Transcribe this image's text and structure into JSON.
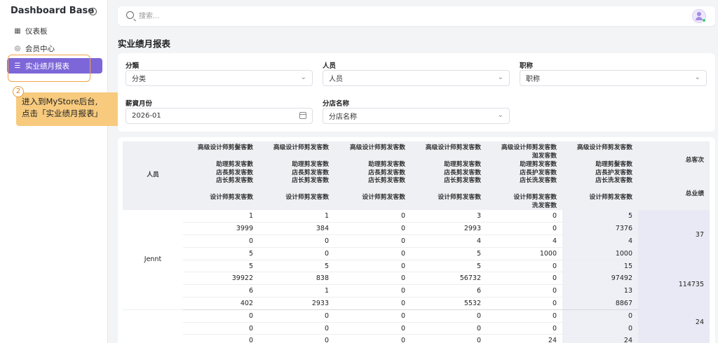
{
  "app": {
    "title": "Dashboard Base"
  },
  "sidebar": {
    "items": [
      {
        "label": "仪表板",
        "icon": "grid-icon"
      },
      {
        "label": "会员中心",
        "icon": "user-circle-icon"
      },
      {
        "label": "实业绩月报表",
        "icon": "list-icon",
        "active": true
      }
    ]
  },
  "callout": {
    "step": "2",
    "line1": "进入到MyStore后台,",
    "line2": "点击「实业绩月报表」"
  },
  "search": {
    "placeholder": "搜索..."
  },
  "page": {
    "title": "实业绩月报表"
  },
  "filters": {
    "category": {
      "label": "分類",
      "value": "分类"
    },
    "staff": {
      "label": "人员",
      "value": "人员"
    },
    "title": {
      "label": "职称",
      "value": "职称"
    },
    "month": {
      "label": "薪資月份",
      "value": "2026-01"
    },
    "branch": {
      "label": "分店名称",
      "value": "分店名称"
    }
  },
  "table": {
    "person_header": "人员",
    "col_headers": [
      {
        "l1": "高级设计师剪髮客數",
        "l1b": "",
        "l2a": "助理剪发客數",
        "l2b": "店長剪发客数",
        "l2c": "店长剪发客数",
        "l3": "设计师剪发客数",
        "l3b": ""
      },
      {
        "l1": "高级设计师剪发客数",
        "l1b": "",
        "l2a": "助理剪发客数",
        "l2b": "店長剪发客数",
        "l2c": "店长剪发客数",
        "l3": "设计师剪发客数",
        "l3b": ""
      },
      {
        "l1": "高级设计师剪发客数",
        "l1b": "",
        "l2a": "助理剪发客数",
        "l2b": "店長剪发客数",
        "l2c": "店长剪发客数",
        "l3": "设计师剪发客数",
        "l3b": ""
      },
      {
        "l1": "高级设计师剪发客数",
        "l1b": "",
        "l2a": "助理剪发客数",
        "l2b": "店長剪发客数",
        "l2c": "店长剪发客数",
        "l3": "设计师剪发客数",
        "l3b": ""
      },
      {
        "l1": "高级设计师剪发客数",
        "l1b": "洳发客数",
        "l2a": "助理剪发客数",
        "l2b": "店長护发客数",
        "l2c": "店长洗发客数",
        "l3": "设计师剪发客数",
        "l3b": "洗发客数"
      },
      {
        "l1": "高级设计师剪发客数",
        "l1b": "",
        "l2a": "助理剪髮客数",
        "l2b": "店長护发客数",
        "l2c": "店长洗发客数",
        "l3": "设计师剪发客数",
        "l3b": ""
      }
    ],
    "total_header_1": "总客次",
    "total_header_2": "总业绩",
    "groups": [
      {
        "person": "Jennt",
        "total_count": "37",
        "total_perf": "114735",
        "rows": [
          [
            "1",
            "1",
            "0",
            "3",
            "0",
            "5"
          ],
          [
            "3999",
            "384",
            "0",
            "2993",
            "0",
            "7376"
          ],
          [
            "0",
            "0",
            "0",
            "4",
            "4",
            "4"
          ],
          [
            "5",
            "0",
            "0",
            "5",
            "1000",
            "1000"
          ],
          [
            "5",
            "5",
            "0",
            "5",
            "0",
            "15"
          ],
          [
            "39922",
            "838",
            "0",
            "56732",
            "0",
            "97492"
          ],
          [
            "6",
            "1",
            "0",
            "6",
            "0",
            "13"
          ],
          [
            "402",
            "2933",
            "0",
            "5532",
            "0",
            "8867"
          ]
        ]
      },
      {
        "person": "",
        "total_count": "24",
        "total_perf": "",
        "rows": [
          [
            "0",
            "0",
            "0",
            "0",
            "0",
            "0"
          ],
          [
            "0",
            "0",
            "0",
            "0",
            "0",
            "0"
          ],
          [
            "0",
            "0",
            "0",
            "0",
            "24",
            "24"
          ]
        ]
      }
    ]
  }
}
